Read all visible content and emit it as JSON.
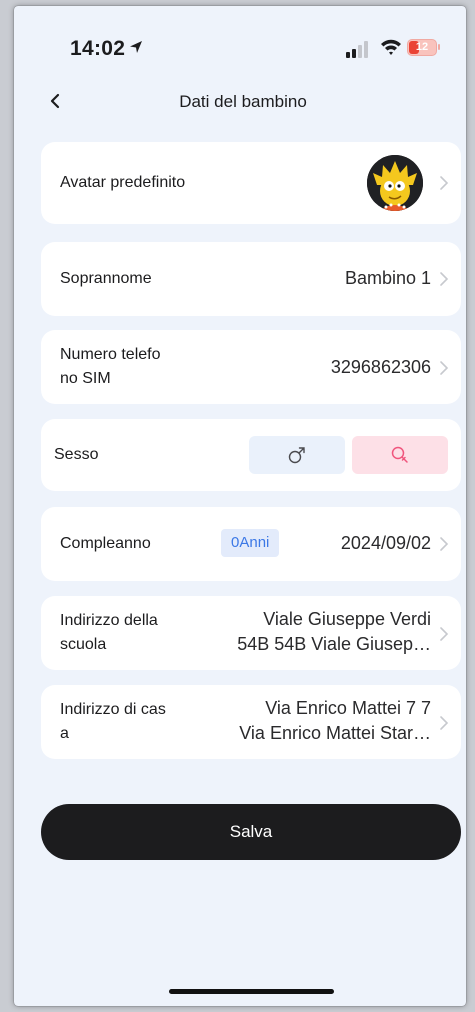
{
  "status_bar": {
    "time": "14:02",
    "battery": "12"
  },
  "header": {
    "title": "Dati del bambino"
  },
  "avatar_row": {
    "label": "Avatar predefinito"
  },
  "nickname_row": {
    "label": "Soprannome",
    "value": "Bambino 1"
  },
  "phone_row": {
    "label_line1": "Numero telefo",
    "label_line2": "no SIM",
    "value": "3296862306"
  },
  "gender_row": {
    "label": "Sesso",
    "male_symbol": "♂",
    "female_symbol": "♀",
    "selected": "female"
  },
  "birthday_row": {
    "label": "Compleanno",
    "age": "0Anni",
    "value": "2024/09/02"
  },
  "school_row": {
    "label_line1": "Indirizzo della",
    "label_line2": "scuola",
    "value_line1": "Viale Giuseppe Verdi",
    "value_line2": "54B 54B Viale Giusep…"
  },
  "home_row": {
    "label_line1": "Indirizzo di cas",
    "label_line2": "a",
    "value_line1": "Via Enrico Mattei 7 7",
    "value_line2": "Via Enrico Mattei Star…"
  },
  "actions": {
    "save_label": "Salva"
  },
  "colors": {
    "background": "#eef3fb",
    "accent": "#3c78e6",
    "female_selected_bg": "#fde0e7",
    "female_icon": "#f0557d",
    "male_bg": "#eaf1fb",
    "button": "#1c1c1e"
  },
  "icons": {
    "back": "chevron-left-icon",
    "row_chevron": "chevron-right-icon",
    "male": "male-icon",
    "female": "female-icon"
  }
}
